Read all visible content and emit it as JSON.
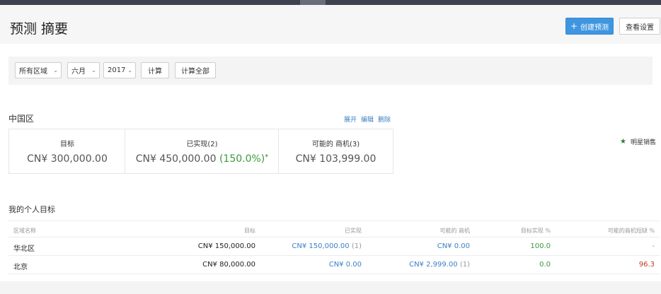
{
  "header": {
    "title": "预测 摘要",
    "create_label": "创建预测",
    "view_settings_label": "查看设置"
  },
  "filters": {
    "region": "所有区域",
    "month": "六月",
    "year": "2017",
    "calc_label": "计算",
    "calc_all_label": "计算全部"
  },
  "region": {
    "name": "中国区",
    "links": [
      "展开",
      "编辑",
      "删除"
    ],
    "target_label": "目标",
    "target_value": "CN¥ 300,000.00",
    "achieved_label": "已实现(2)",
    "achieved_value": "CN¥ 450,000.00",
    "achieved_pct": "(150.0%)",
    "achieved_star": "*",
    "opportunity_label": "可能的 商机(3)",
    "opportunity_value": "CN¥ 103,999.00",
    "star_sales_label": "明星销售"
  },
  "personal": {
    "title": "我的个人目标",
    "columns": [
      "区域名称",
      "目标",
      "已实现",
      "可能的 商机",
      "目标实现 %",
      "可能的商机短缺 %"
    ],
    "rows": [
      {
        "region": "华北区",
        "target": "CN¥ 150,000.00",
        "achieved": "CN¥ 150,000.00",
        "achieved_count": "(1)",
        "opportunity": "CN¥ 0.00",
        "opportunity_count": "",
        "achieved_pct": "100.0",
        "shortfall_pct": "-"
      },
      {
        "region": "北京",
        "target": "CN¥ 80,000.00",
        "achieved": "CN¥ 0.00",
        "achieved_count": "",
        "opportunity": "CN¥ 2,999.00",
        "opportunity_count": "(1)",
        "achieved_pct": "0.0",
        "shortfall_pct": "96.3"
      }
    ]
  },
  "colors": {
    "accent": "#3f95e0",
    "link": "#3b80c6",
    "positive": "#3c9a3c",
    "negative": "#c0392b",
    "topbar": "#3d4150"
  },
  "icons": {
    "create": "plus-icon",
    "dropdown": "chevron-down-icon",
    "star": "star-icon"
  }
}
